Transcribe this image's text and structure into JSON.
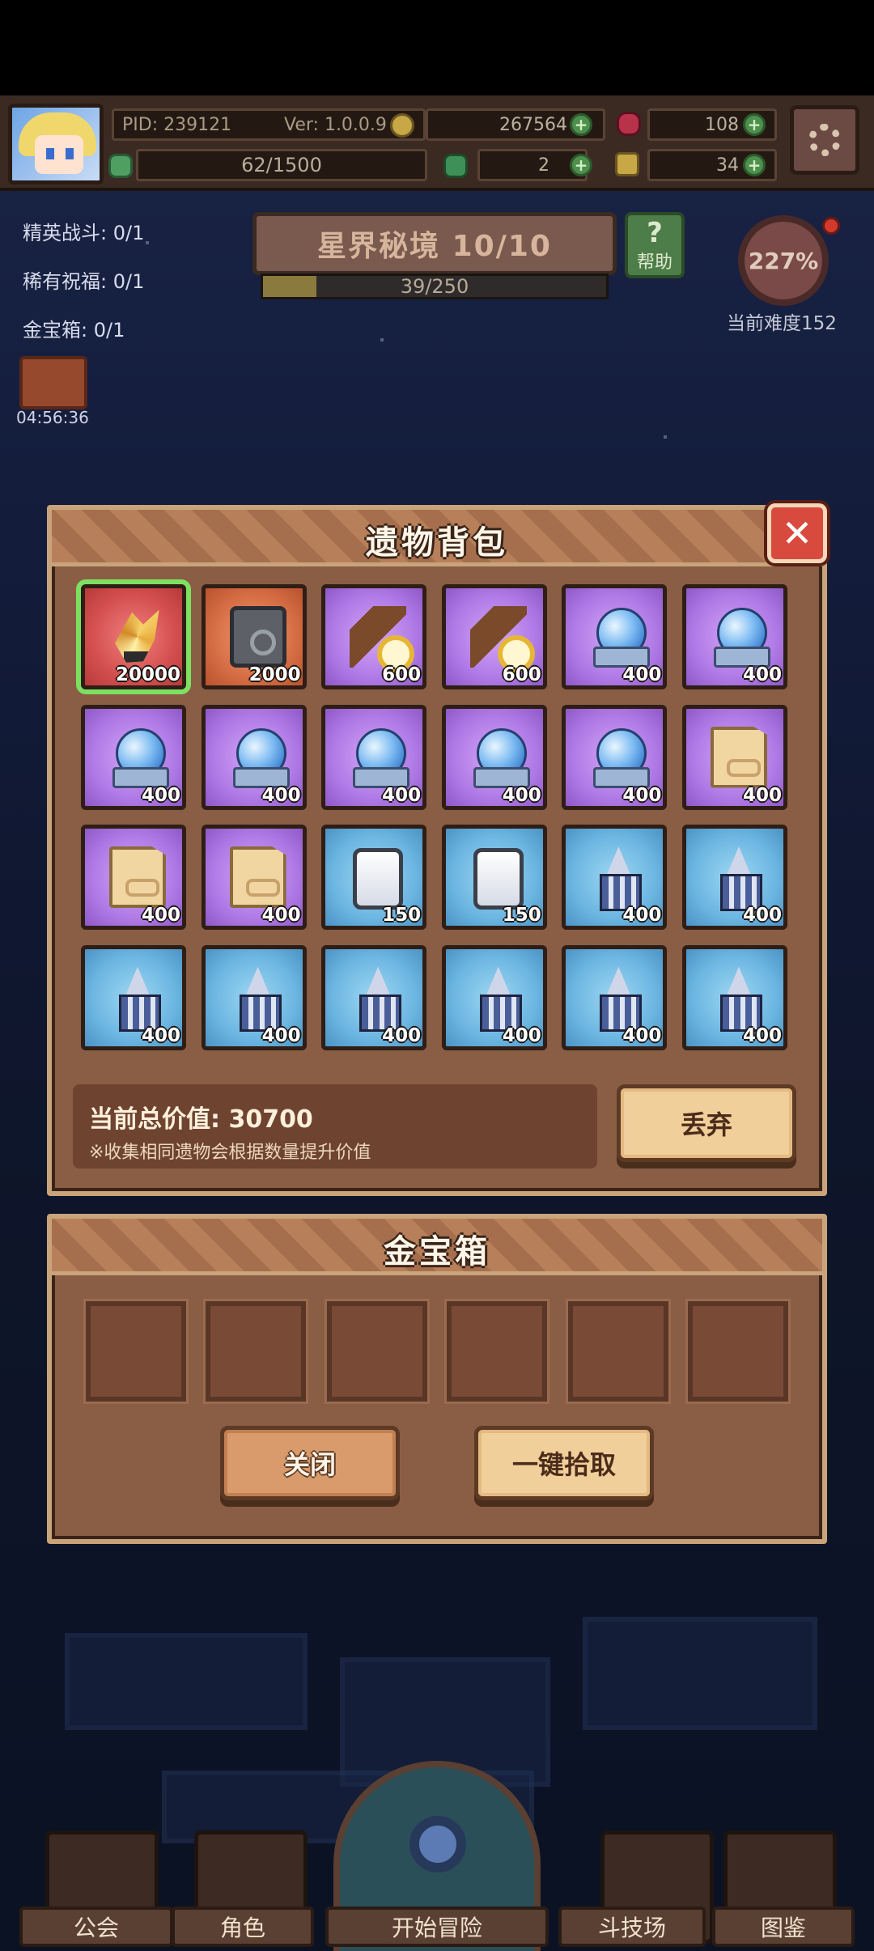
{
  "hud": {
    "pid": "PID: 239121",
    "version": "Ver: 1.0.0.9",
    "gold": "267564",
    "gems": "108",
    "stamina": "62/1500",
    "clover": "2",
    "keys": "34"
  },
  "quests": {
    "elite": "精英战斗: 0/1",
    "rare": "稀有祝福: 0/1",
    "chest": "金宝箱: 0/1",
    "timer": "04:56:36"
  },
  "stage": {
    "title": "星界秘境 10/10",
    "progress_text": "39/250",
    "progress": 0.156,
    "help_label": "帮助",
    "difficulty_percent": "227%",
    "difficulty_label": "当前难度152"
  },
  "relic_bag": {
    "title": "遗物背包",
    "items": [
      {
        "icon": "gold-crystal-icon",
        "rarity": "red",
        "value": "20000",
        "selected": true
      },
      {
        "icon": "iron-box-icon",
        "rarity": "orange",
        "value": "2000"
      },
      {
        "icon": "spyglass-icon",
        "rarity": "purple",
        "value": "600"
      },
      {
        "icon": "spyglass-icon",
        "rarity": "purple",
        "value": "600"
      },
      {
        "icon": "crystal-orb-icon",
        "rarity": "purple",
        "value": "400"
      },
      {
        "icon": "crystal-orb-icon",
        "rarity": "purple",
        "value": "400"
      },
      {
        "icon": "crystal-orb-icon",
        "rarity": "purple",
        "value": "400"
      },
      {
        "icon": "crystal-orb-icon",
        "rarity": "purple",
        "value": "400"
      },
      {
        "icon": "crystal-orb-icon",
        "rarity": "purple",
        "value": "400"
      },
      {
        "icon": "crystal-orb-icon",
        "rarity": "purple",
        "value": "400"
      },
      {
        "icon": "crystal-orb-icon",
        "rarity": "purple",
        "value": "400"
      },
      {
        "icon": "scroll-icon",
        "rarity": "purple",
        "value": "400"
      },
      {
        "icon": "scroll-icon",
        "rarity": "purple",
        "value": "400"
      },
      {
        "icon": "scroll-icon",
        "rarity": "purple",
        "value": "400"
      },
      {
        "icon": "stone-tablet-icon",
        "rarity": "blue",
        "value": "150"
      },
      {
        "icon": "stone-tablet-icon",
        "rarity": "blue",
        "value": "150"
      },
      {
        "icon": "pawn-figure-icon",
        "rarity": "blue",
        "value": "400"
      },
      {
        "icon": "pawn-figure-icon",
        "rarity": "blue",
        "value": "400"
      },
      {
        "icon": "pawn-figure-icon",
        "rarity": "blue",
        "value": "400"
      },
      {
        "icon": "pawn-figure-icon",
        "rarity": "blue",
        "value": "400"
      },
      {
        "icon": "pawn-figure-icon",
        "rarity": "blue",
        "value": "400"
      },
      {
        "icon": "pawn-figure-icon",
        "rarity": "blue",
        "value": "400"
      },
      {
        "icon": "pawn-figure-icon",
        "rarity": "blue",
        "value": "400"
      },
      {
        "icon": "pawn-figure-icon",
        "rarity": "blue",
        "value": "400"
      }
    ],
    "total_label": "当前总价值: 30700",
    "note": "※收集相同遗物会根据数量提升价值",
    "discard_label": "丢弃"
  },
  "gold_chest": {
    "title": "金宝箱",
    "close_label": "关闭",
    "pickup_label": "一键拾取"
  },
  "nav": {
    "guild": "公会",
    "character": "角色",
    "start": "开始冒险",
    "arena": "斗技场",
    "codex": "图鉴"
  },
  "colors": {
    "panel": "#8a5d45",
    "selected": "#7ee061",
    "rarity_red": "#d45050",
    "rarity_orange": "#d66e45",
    "rarity_purple": "#b07ae6",
    "rarity_blue": "#6cb6e2"
  }
}
